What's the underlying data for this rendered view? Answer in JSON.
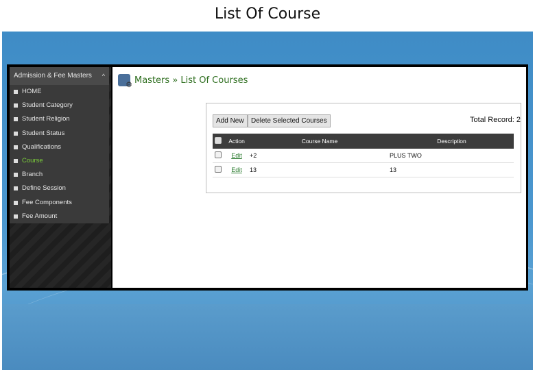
{
  "slide": {
    "title": "List Of Course"
  },
  "sidebar": {
    "header": "Admission & Fee Masters",
    "items": [
      {
        "label": "HOME",
        "active": false
      },
      {
        "label": "Student Category",
        "active": false
      },
      {
        "label": "Student Religion",
        "active": false
      },
      {
        "label": "Student Status",
        "active": false
      },
      {
        "label": "Qualifications",
        "active": false
      },
      {
        "label": "Course",
        "active": true
      },
      {
        "label": "Branch",
        "active": false
      },
      {
        "label": "Define Session",
        "active": false
      },
      {
        "label": "Fee Components",
        "active": false
      },
      {
        "label": "Fee Amount",
        "active": false
      }
    ]
  },
  "page": {
    "heading": "Masters » List Of Courses"
  },
  "toolbar": {
    "add_new": "Add New",
    "delete_selected": "Delete Selected Courses",
    "total_records": "Total Record: 2"
  },
  "table": {
    "headers": {
      "action": "Action",
      "course_name": "Course Name",
      "description": "Description"
    },
    "rows": [
      {
        "action": "Edit",
        "course_name": "+2",
        "description": "PLUS TWO"
      },
      {
        "action": "Edit",
        "course_name": "13",
        "description": "13"
      }
    ]
  },
  "colors": {
    "active_menu": "#7ccf3a",
    "heading_green": "#2e6e1f",
    "grid_header": "#3c3c3c",
    "slide_blue": "#4b97cf"
  }
}
